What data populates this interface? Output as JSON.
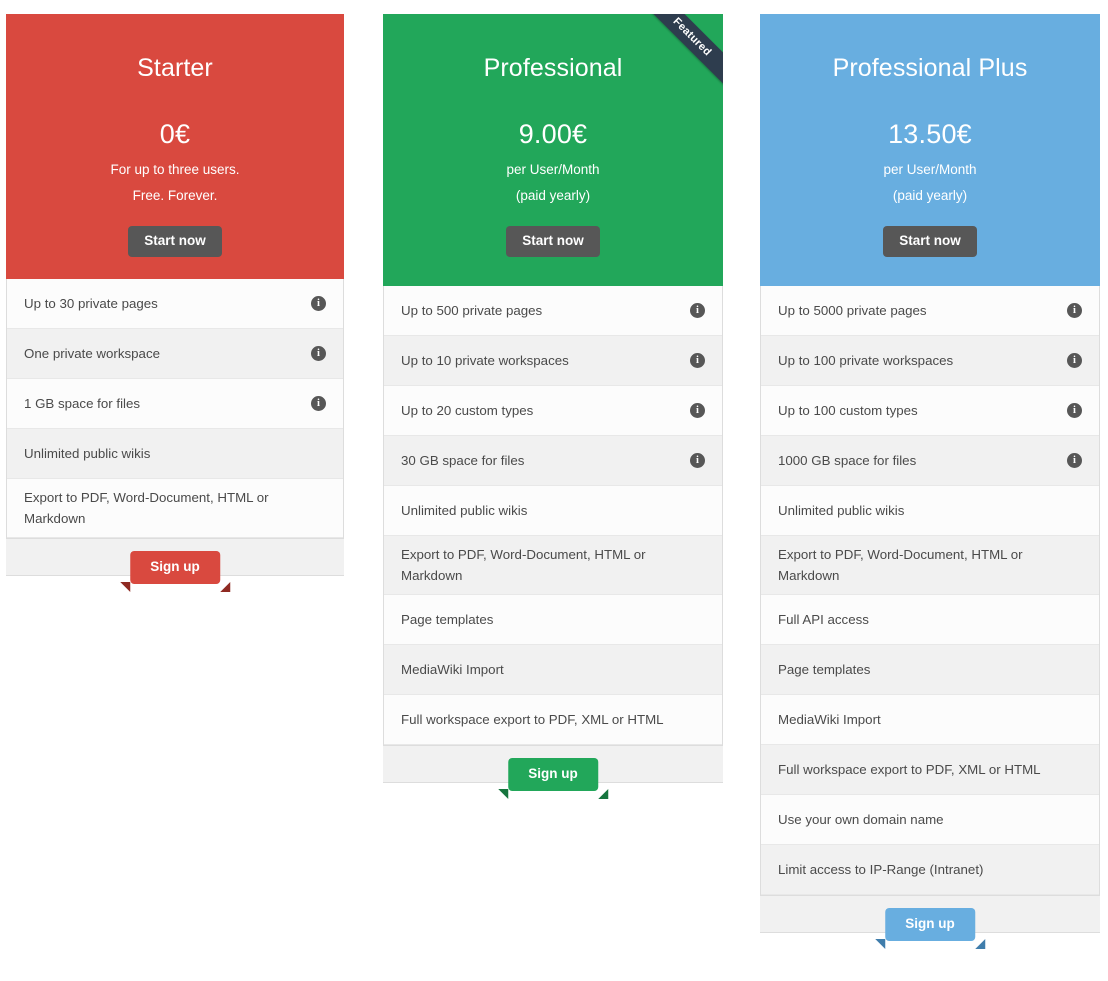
{
  "page": {
    "currency_symbol": "€",
    "colors": {
      "starter": "#d9493f",
      "professional": "#22a75a",
      "professional_plus": "#68aee0",
      "button_dark": "#575757",
      "ribbon_dark": "#2e3d4e",
      "row_light": "#fcfcfc",
      "row_alt": "#f1f1f1"
    },
    "info_icon_glyph": "i"
  },
  "plans": [
    {
      "id": "starter",
      "name": "Starter",
      "price": "0€",
      "sub_lines": [
        "For up to three users.",
        "Free. Forever."
      ],
      "cta_top": "Start now",
      "cta_bottom": "Sign up",
      "featured": false,
      "featured_label": "",
      "features": [
        {
          "text": "Up to 30 private pages",
          "info": true
        },
        {
          "text": "One private workspace",
          "info": true
        },
        {
          "text": "1 GB space for files",
          "info": true
        },
        {
          "text": "Unlimited public wikis",
          "info": false
        },
        {
          "text": "Export to PDF, Word-Document, HTML or Markdown",
          "info": false
        }
      ]
    },
    {
      "id": "professional",
      "name": "Professional",
      "price": "9.00€",
      "sub_lines": [
        "per User/Month",
        "(paid yearly)"
      ],
      "cta_top": "Start now",
      "cta_bottom": "Sign up",
      "featured": true,
      "featured_label": "Featured",
      "features": [
        {
          "text": "Up to 500 private pages",
          "info": true
        },
        {
          "text": "Up to 10 private workspaces",
          "info": true
        },
        {
          "text": "Up to 20 custom types",
          "info": true
        },
        {
          "text": "30 GB space for files",
          "info": true
        },
        {
          "text": "Unlimited public wikis",
          "info": false
        },
        {
          "text": "Export to PDF, Word-Document, HTML or Markdown",
          "info": false
        },
        {
          "text": "Page templates",
          "info": false
        },
        {
          "text": "MediaWiki Import",
          "info": false
        },
        {
          "text": "Full workspace export to PDF, XML or HTML",
          "info": false
        }
      ]
    },
    {
      "id": "professional_plus",
      "name": "Professional Plus",
      "price": "13.50€",
      "sub_lines": [
        "per User/Month",
        "(paid yearly)"
      ],
      "cta_top": "Start now",
      "cta_bottom": "Sign up",
      "featured": false,
      "featured_label": "",
      "features": [
        {
          "text": "Up to 5000 private pages",
          "info": true
        },
        {
          "text": "Up to 100 private workspaces",
          "info": true
        },
        {
          "text": "Up to 100 custom types",
          "info": true
        },
        {
          "text": "1000 GB space for files",
          "info": true
        },
        {
          "text": "Unlimited public wikis",
          "info": false
        },
        {
          "text": "Export to PDF, Word-Document, HTML or Markdown",
          "info": false
        },
        {
          "text": "Full API access",
          "info": false
        },
        {
          "text": "Page templates",
          "info": false
        },
        {
          "text": "MediaWiki Import",
          "info": false
        },
        {
          "text": "Full workspace export to PDF, XML or HTML",
          "info": false
        },
        {
          "text": "Use your own domain name",
          "info": false
        },
        {
          "text": "Limit access to IP-Range (Intranet)",
          "info": false
        }
      ]
    }
  ]
}
